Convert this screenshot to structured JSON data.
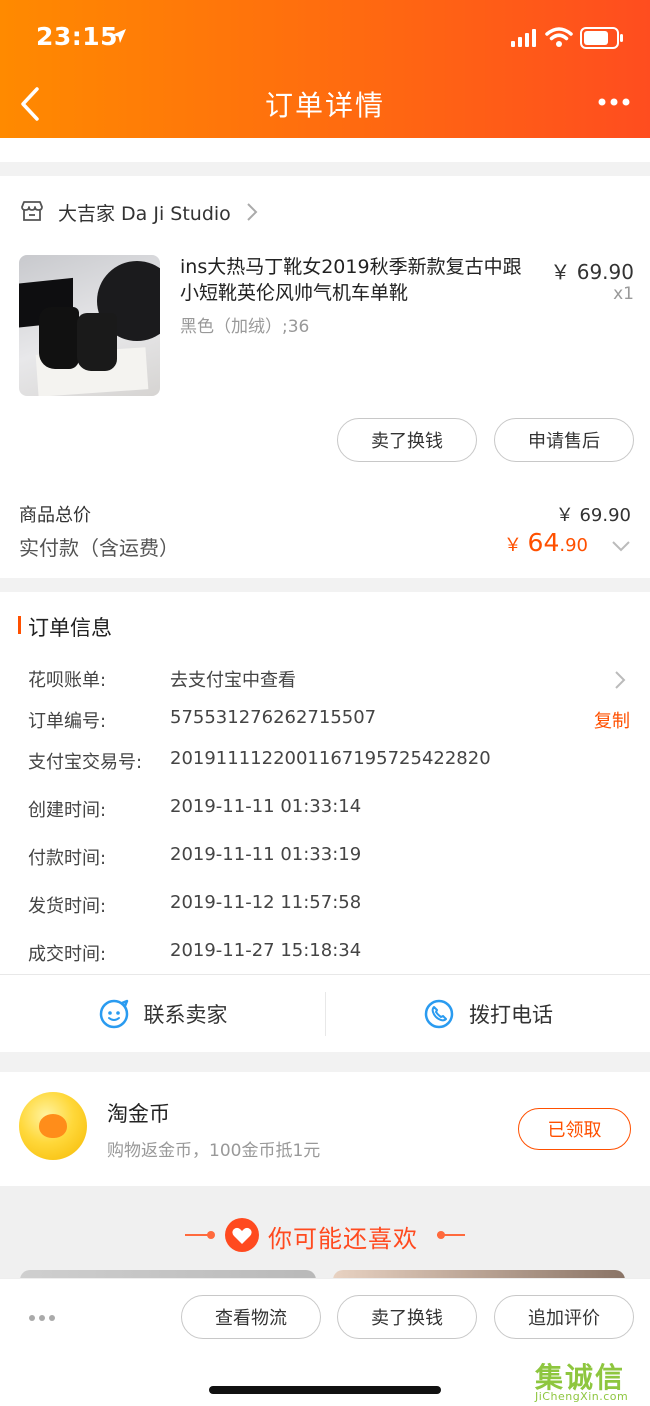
{
  "status_bar": {
    "time": "23:15"
  },
  "nav": {
    "title": "订单详情"
  },
  "shop": {
    "name": "大吉家 Da Ji Studio"
  },
  "product": {
    "title": "ins大热马丁靴女2019秋季新款复古中跟小短靴英伦风帅气机车单靴",
    "variant": "黑色（加绒）;36",
    "price": "￥ 69.90",
    "quantity": "x1"
  },
  "product_actions": {
    "sell_label": "卖了换钱",
    "aftersale_label": "申请售后"
  },
  "totals": {
    "subtotal_label": "商品总价",
    "subtotal_value": "￥ 69.90",
    "paid_label": "实付款（含运费）",
    "paid_symbol": "￥ ",
    "paid_int": "64",
    "paid_dec": ".90"
  },
  "order_info": {
    "title": "订单信息",
    "rows": [
      {
        "label": "花呗账单:",
        "value": "去支付宝中查看"
      },
      {
        "label": "订单编号:",
        "value": "575531276262715507",
        "action": "复制"
      },
      {
        "label": "支付宝交易号:",
        "value": "2019111122001167195725422820"
      },
      {
        "label": "创建时间:",
        "value": "2019-11-11 01:33:14"
      },
      {
        "label": "付款时间:",
        "value": "2019-11-11 01:33:19"
      },
      {
        "label": "发货时间:",
        "value": "2019-11-12 11:57:58"
      },
      {
        "label": "成交时间:",
        "value": "2019-11-27 15:18:34"
      }
    ]
  },
  "contact": {
    "seller_label": "联系卖家",
    "call_label": "拨打电话"
  },
  "coins": {
    "title": "淘金币",
    "desc": "购物返金币，100金币抵1元",
    "claimed_label": "已领取"
  },
  "recommend": {
    "title": "你可能还喜欢"
  },
  "bottom_bar": {
    "logistics_label": "查看物流",
    "sell_label": "卖了换钱",
    "review_label": "追加评价"
  },
  "watermark": {
    "logo": "集诚信",
    "url": "JiChengXin.com"
  },
  "colors": {
    "accent": "#ff5000",
    "header_start": "#ff8a00",
    "header_end": "#ff4d1f",
    "watermark": "#8ec63f"
  },
  "icons": [
    "location-arrow-icon",
    "signal-icon",
    "wifi-icon",
    "battery-icon",
    "back-icon",
    "more-icon",
    "shop-icon",
    "chevron-right-icon",
    "chevron-down-icon",
    "chat-icon",
    "phone-icon",
    "coin-icon",
    "heart-icon",
    "dots-icon"
  ]
}
